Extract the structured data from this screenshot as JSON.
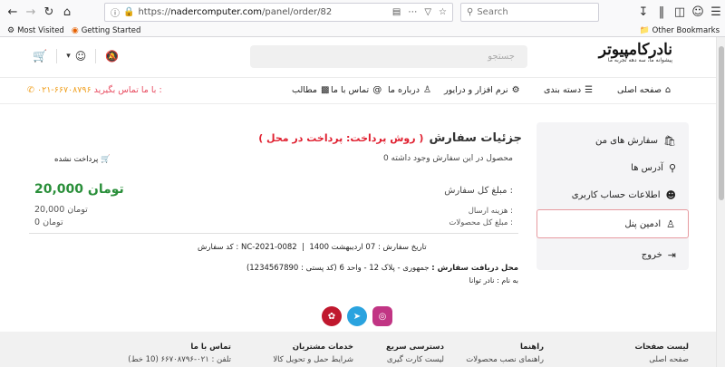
{
  "browser": {
    "url_prefix": "https://",
    "url_host": "nadercomputer.com",
    "url_path": "/panel/order/82",
    "search_placeholder": "Search",
    "bookmarks": [
      "Most Visited",
      "Getting Started"
    ],
    "other_bookmarks": "Other Bookmarks"
  },
  "site": {
    "logo_text": "نادرکامپیوتر",
    "logo_tagline": "پیشوانه ما، سه دهه تجربه ما",
    "search_placeholder": "جستجو",
    "nav": [
      "صفحه اصلی",
      "دسته بندی",
      "نرم افزار و درایور",
      "درباره ما",
      "تماس با ما",
      "مطالب"
    ],
    "contact_label": "با ما تماس بگیرید :",
    "contact_phone": "۰۲۱-۶۶۷۰۸۷۹۶"
  },
  "sidebar": {
    "items": [
      "سفارش های من",
      "آدرس ها",
      "اطلاعات حساب کاربری",
      "ادمین پنل",
      "خروج"
    ]
  },
  "order": {
    "title": "جزئیات سفارش",
    "payment_method": "( روش پرداخت: پرداخت در محل )",
    "items_note": "0 محصول در این سفارش وجود داشته",
    "payment_status": "پرداخت نشده",
    "total_label": "مبلغ کل سفارش :",
    "total_amount": "20,000  تومان",
    "shipping_label": "هزینه ارسال :",
    "shipping_amount": "20,000  تومان",
    "products_label": "مبلغ کل محصولات :",
    "products_amount": "0  تومان",
    "code_line": "کد سفارش : NC-2021-0082",
    "date_line": "تاریخ سفارش : 07 اردیبهشت 1400",
    "address_label": "محل دریافت سفارش :",
    "address_value": "جمهوری - پلاک 12 - واحد 6 (کد پستی : 1234567890)",
    "recipient": "به نام : نادر توانا"
  },
  "footer": {
    "cols": [
      {
        "title": "لیست صفحات",
        "link": "صفحه اصلی"
      },
      {
        "title": "راهنما",
        "link": "راهنمای نصب محصولات"
      },
      {
        "title": "دسترسی سریع",
        "link": "لیست کارت گیری"
      },
      {
        "title": "خدمات مشتریان",
        "link": "شرایط حمل و تحویل کالا"
      },
      {
        "title": "تماس با ما",
        "link": "تلفن : ۰۲۱-۶۶۷۰۸۷۹۶ (10 خط)"
      }
    ]
  },
  "colors": {
    "accent_red": "#e02030",
    "price_green": "#2a8f3a",
    "phone_orange": "#f0a020"
  }
}
